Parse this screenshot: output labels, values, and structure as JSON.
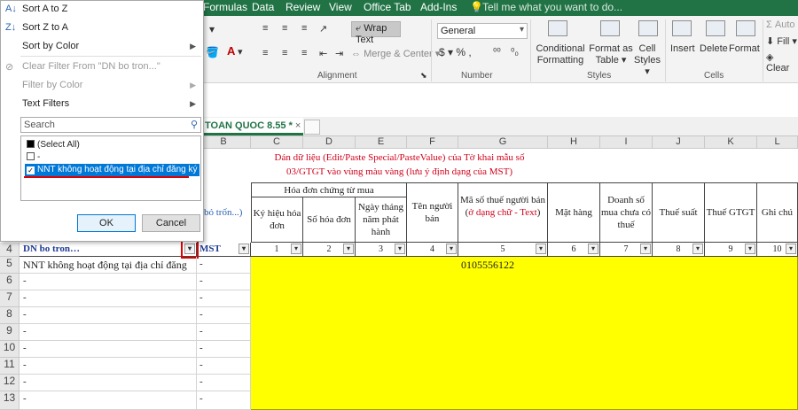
{
  "menu": {
    "tabs": [
      "Formulas",
      "Data",
      "Review",
      "View",
      "Office Tab",
      "Add-Ins"
    ],
    "tell_me": "Tell me what you want to do..."
  },
  "ribbon": {
    "wrap_text": "Wrap Text",
    "merge_center": "Merge & Center",
    "alignment_label": "Alignment",
    "number_format": "General",
    "number_label": "Number",
    "conditional_formatting": [
      "Conditional",
      "Formatting"
    ],
    "format_as_table": [
      "Format as",
      "Table"
    ],
    "cell_styles": [
      "Cell",
      "Styles"
    ],
    "styles_label": "Styles",
    "insert": "Insert",
    "delete": "Delete",
    "format": "Format",
    "cells_label": "Cells",
    "auto": "Auto",
    "fill": "Fill",
    "clear": "Clear",
    "percent": "$ ▾ % ,"
  },
  "sheet_tab": {
    "name": "TOAN QUOC 8.55",
    "modified_marker": "*",
    "close": "×"
  },
  "filter_menu": {
    "sort_az": "Sort A to Z",
    "sort_za": "Sort Z to A",
    "sort_by_color": "Sort by Color",
    "clear_filter": "Clear Filter From \"DN bo tron...\"",
    "filter_by_color": "Filter by Color",
    "text_filters": "Text Filters",
    "search_placeholder": "Search",
    "items": {
      "select_all": "(Select All)",
      "dash": "-",
      "nnt": "NNT không hoạt động tại địa chỉ đăng ký"
    },
    "ok": "OK",
    "cancel": "Cancel"
  },
  "grid": {
    "columns": [
      "B",
      "C",
      "D",
      "E",
      "F",
      "G",
      "H",
      "I",
      "J",
      "K",
      "L"
    ],
    "rows": [
      "4",
      "5",
      "6",
      "7",
      "8",
      "9",
      "10",
      "11",
      "12",
      "13"
    ],
    "instruction_line1": "Dán dữ liệu (Edit/Paste Special/PasteValue) của Tờ khai mẫu số",
    "instruction_line2": "03/GTGT vào vùng màu vàng (lưu ý định dạng của MST)",
    "group_header": "Hóa đơn chứng từ mua",
    "b_header_partial": "bỏ trốn...)",
    "headers": {
      "c": "Ký hiệu hóa đơn",
      "d": "Số hóa đơn",
      "e": "Ngày tháng năm phát hành",
      "f": "Tên người bán",
      "g_main": "Mã số thuế người bán (",
      "g_red": "ở dạng chữ - Text",
      "g_end": ")",
      "h": "Mặt hàng",
      "i": "Doanh số mua chưa có thuế",
      "j": "Thuế suất",
      "k": "Thuế GTGT",
      "l": "Ghi chú"
    },
    "numbers": [
      "1",
      "2",
      "3",
      "4",
      "5",
      "6",
      "7",
      "8",
      "9",
      "10"
    ],
    "row4_a": "DN bo tron…",
    "row4_b": "MST",
    "row5_a": "NNT không hoạt động tại địa chỉ đăng ký",
    "row5_b": "-",
    "row5_g": "0105556122",
    "dash": "-"
  }
}
